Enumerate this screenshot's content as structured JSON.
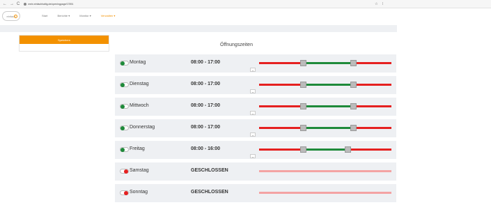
{
  "browser": {
    "back": "←",
    "forward": "→",
    "reload": "C",
    "url": "mein.einfachhaltig.de/openingpage/17891",
    "star": "☆",
    "menu": "⁞"
  },
  "header": {
    "logo_text": "einfach",
    "nav": [
      {
        "label": "Start",
        "active": false
      },
      {
        "label": "Berichte ▾",
        "active": false
      },
      {
        "label": "Monitor ▾",
        "active": false
      },
      {
        "label": "Verwalten ▾",
        "active": true
      }
    ]
  },
  "side_panel": {
    "button_label": "Speichern"
  },
  "page_title": "Öffnungszeiten",
  "days": [
    {
      "name": "Montag",
      "hours": "08:00 - 17:00",
      "open": true,
      "range_start": 0.333,
      "range_end": 0.7083
    },
    {
      "name": "Dienstag",
      "hours": "08:00 - 17:00",
      "open": true,
      "range_start": 0.333,
      "range_end": 0.7083
    },
    {
      "name": "Mittwoch",
      "hours": "08:00 - 17:00",
      "open": true,
      "range_start": 0.333,
      "range_end": 0.7083
    },
    {
      "name": "Donnerstag",
      "hours": "08:00 - 17:00",
      "open": true,
      "range_start": 0.333,
      "range_end": 0.7083
    },
    {
      "name": "Freitag",
      "hours": "08:00 - 16:00",
      "open": true,
      "range_start": 0.333,
      "range_end": 0.6667
    },
    {
      "name": "Samstag",
      "hours": "GESCHLOSSEN",
      "open": false
    },
    {
      "name": "Sonntag",
      "hours": "GESCHLOSSEN",
      "open": false
    }
  ],
  "colors": {
    "accent": "#f39100",
    "open": "#1e8a3a",
    "closed": "#e52020",
    "closed_light": "#f4a3a3"
  }
}
